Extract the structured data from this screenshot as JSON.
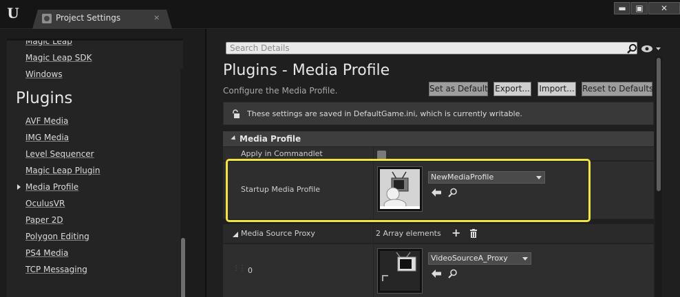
{
  "window": {
    "tab_title": "Project Settings",
    "tab_close": "×",
    "controls": {
      "minimize": "▬",
      "maximize": "▣",
      "close": "✕"
    }
  },
  "sidebar": {
    "items_top": [
      {
        "label": "Magic Leap"
      },
      {
        "label": "Magic Leap SDK"
      },
      {
        "label": "Windows"
      }
    ],
    "section_title": "Plugins",
    "items": [
      {
        "label": "AVF Media"
      },
      {
        "label": "IMG Media"
      },
      {
        "label": "Level Sequencer"
      },
      {
        "label": "Magic Leap Plugin"
      },
      {
        "label": "Media Profile",
        "selected": true
      },
      {
        "label": "OculusVR"
      },
      {
        "label": "Paper 2D"
      },
      {
        "label": "Polygon Editing"
      },
      {
        "label": "PS4 Media"
      },
      {
        "label": "TCP Messaging"
      }
    ]
  },
  "details": {
    "search_placeholder": "Search Details",
    "title": "Plugins - Media Profile",
    "subtitle": "Configure the Media Profile.",
    "buttons": {
      "set_default": "Set as Default",
      "export": "Export...",
      "import": "Import...",
      "reset": "Reset to Defaults"
    },
    "notice": "These settings are saved in DefaultGame.ini, which is currently writable.",
    "category": "Media Profile",
    "rows": {
      "apply_commandlet": {
        "label": "Apply in Commandlet",
        "checked": false
      },
      "startup_profile": {
        "label": "Startup Media Profile",
        "value": "NewMediaProfile"
      },
      "source_proxy": {
        "label": "Media Source Proxy",
        "count_text": "2 Array elements"
      },
      "element0": {
        "index": "0",
        "value": "VideoSourceA_Proxy"
      }
    }
  },
  "colors": {
    "highlight": "#f2e443",
    "panel": "#1f1f1f",
    "row": "#2e2e2e"
  }
}
